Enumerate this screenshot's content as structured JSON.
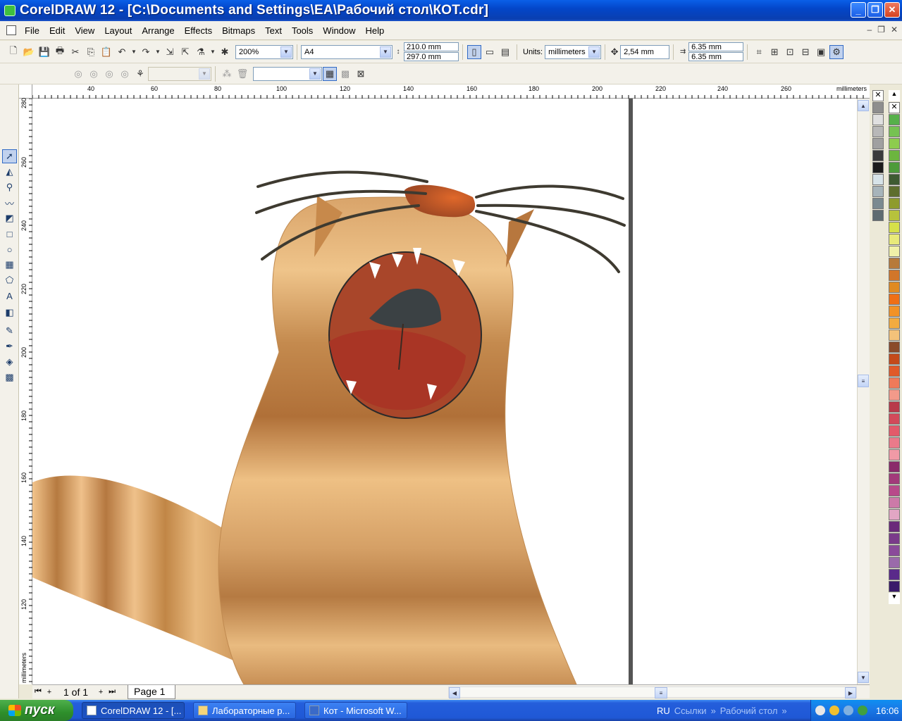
{
  "window": {
    "title": "CorelDRAW 12 - [C:\\Documents and Settings\\EA\\Рабочий стол\\КОТ.cdr]"
  },
  "menu": [
    "File",
    "Edit",
    "View",
    "Layout",
    "Arrange",
    "Effects",
    "Bitmaps",
    "Text",
    "Tools",
    "Window",
    "Help"
  ],
  "toolbar1": {
    "zoom": "200%",
    "paper": "A4",
    "width": "210.0 mm",
    "height": "297.0 mm",
    "units_label": "Units:",
    "units": "millimeters",
    "nudge": "2,54 mm",
    "dup_x": "6.35 mm",
    "dup_y": "6.35 mm"
  },
  "ruler": {
    "units": "millimeters",
    "top_ticks": [
      "40",
      "60",
      "80",
      "100",
      "120",
      "140",
      "160",
      "180",
      "200",
      "220",
      "240",
      "260"
    ],
    "left_ticks": [
      "280",
      "260",
      "240",
      "220",
      "200",
      "180",
      "160",
      "140",
      "120"
    ]
  },
  "pagenav": {
    "counter": "1 of 1",
    "page_tab": "Page 1"
  },
  "taskbar": {
    "start": "пуск",
    "tasks": [
      "CorelDRAW 12 - [...",
      "Лабораторные р...",
      "Кот - Microsoft W..."
    ],
    "lang": "RU",
    "links": "Ссылки",
    "desktop": "Рабочий стол",
    "clock": "16:06"
  },
  "palette": {
    "col1": [
      "#8e8e8e",
      "#e0e0e0",
      "#b8b8b8",
      "#a0a0a0",
      "#3a3a3a",
      "#1c1c1c",
      "#d7e3e8",
      "#a7b4ba",
      "#7b8a90",
      "#5e6b70"
    ],
    "col2": [
      "#56b04a",
      "#76c252",
      "#8dcc4e",
      "#6cb53f",
      "#4d9b3a",
      "#3e5a32",
      "#5e6e2e",
      "#8e9b2e",
      "#b7c23c",
      "#d6e04a",
      "#e8ea7a",
      "#f1f1a8",
      "#b77a3a",
      "#d1762a",
      "#e08a22",
      "#ef6f16",
      "#f29226",
      "#f3ab40",
      "#f3c27a",
      "#8a4a2a",
      "#c44a1a",
      "#e05a2a",
      "#ef7a5a",
      "#f29a8a",
      "#b83a4a",
      "#d24a5a",
      "#e35a6a",
      "#ea7a8a",
      "#f09aa6",
      "#8a2a6a",
      "#a23a7a",
      "#b84a8a",
      "#cc7aa8",
      "#e2a6c4",
      "#6a2a7a",
      "#7a3a8a",
      "#8a4a9a",
      "#9a6aaa",
      "#5a2a8a",
      "#3a1a6a"
    ]
  }
}
